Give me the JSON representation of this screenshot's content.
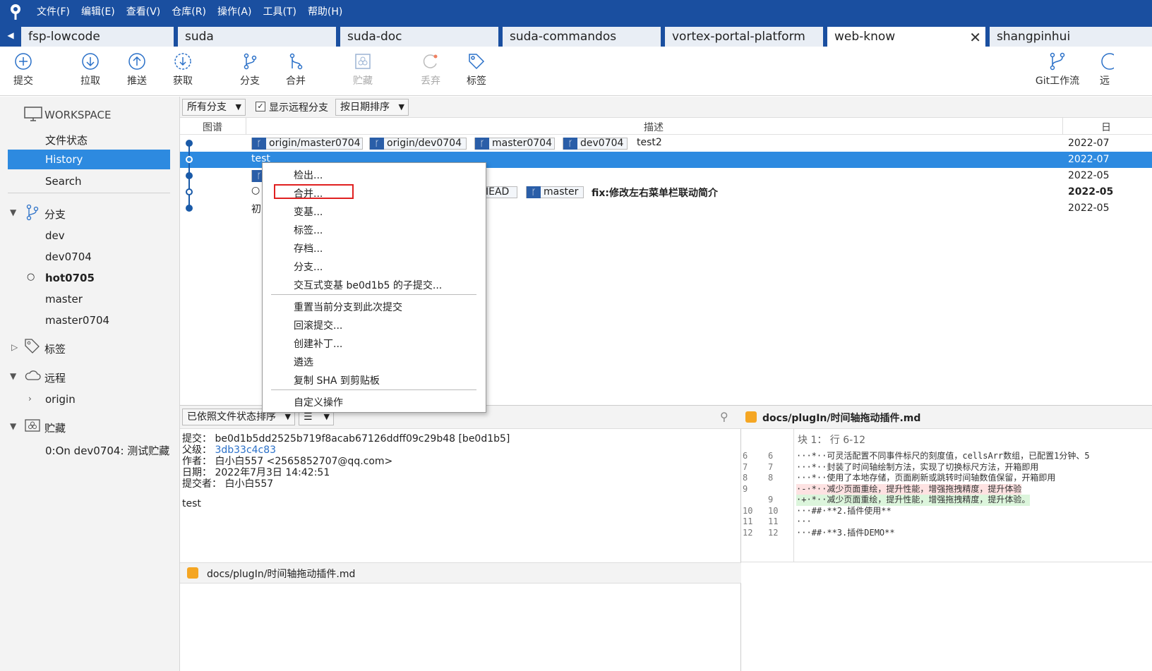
{
  "menu": [
    "文件(F)",
    "编辑(E)",
    "查看(V)",
    "仓库(R)",
    "操作(A)",
    "工具(T)",
    "帮助(H)"
  ],
  "tabs": [
    "fsp-lowcode",
    "suda",
    "suda-doc",
    "suda-commandos",
    "vortex-portal-platform",
    "web-know",
    "shangpinhui"
  ],
  "active_tab": "web-know",
  "toolbar": {
    "commit": "提交",
    "pull": "拉取",
    "push": "推送",
    "fetch": "获取",
    "branch": "分支",
    "merge": "合并",
    "stash": "贮藏",
    "discard": "丢弃",
    "tag": "标签",
    "gitflow": "Git工作流",
    "remote": "远"
  },
  "sidebar": {
    "workspace": "WORKSPACE",
    "file_status": "文件状态",
    "history": "History",
    "search": "Search",
    "branches": "分支",
    "branch_items": [
      "dev",
      "dev0704",
      "hot0705",
      "master",
      "master0704"
    ],
    "tags": "标签",
    "remotes": "远程",
    "remote_items": [
      "origin"
    ],
    "stashes": "贮藏",
    "stash_items": [
      "0:On dev0704: 测试贮藏"
    ]
  },
  "filter": {
    "branches": "所有分支",
    "show_remote": "显示远程分支",
    "sort": "按日期排序"
  },
  "columns": {
    "graph": "图谱",
    "desc": "描述",
    "date": "日"
  },
  "commits": [
    {
      "badges": [
        "origin/master0704",
        "origin/dev0704",
        "master0704",
        "dev0704"
      ],
      "msg": "test2",
      "date": "2022-07"
    },
    {
      "badges": [],
      "msg": "test",
      "date": "2022-07"
    },
    {
      "badges": [],
      "msg": "",
      "date": "2022-05"
    },
    {
      "badges": [
        "IEAD",
        "master"
      ],
      "msg": "fix:修改左右菜单栏联动简介",
      "date": "2022-05"
    },
    {
      "badges": [],
      "msg": "初",
      "date": "2022-05"
    }
  ],
  "context_menu": {
    "items": [
      "检出...",
      "合并...",
      "变基...",
      "标签...",
      "存档...",
      "分支...",
      "交互式变基 be0d1b5 的子提交...",
      "重置当前分支到此次提交",
      "回滚提交...",
      "创建补丁...",
      "遴选",
      "复制 SHA 到剪贴板",
      "自定义操作"
    ],
    "highlighted": "合并..."
  },
  "details": {
    "sort_label": "已依照文件状态排序",
    "commit_label": "提交：",
    "commit": "be0d1b5dd2525b719f8acab67126ddff09c29b48 [be0d1b5]",
    "parent_label": "父级：",
    "parent": "3db33c4c83",
    "author_label": "作者：",
    "author": "白小白557 <2565852707@qq.com>",
    "date_label": "日期：",
    "date": "2022年7月3日 14:42:51",
    "committer_label": "提交者：",
    "committer": "白小白557",
    "message": "test",
    "file": "docs/plugIn/时间轴拖动插件.md"
  },
  "diff": {
    "file": "docs/plugIn/时间轴拖动插件.md",
    "hunk": "块 1： 行 6-12",
    "lines": [
      {
        "o": "6",
        "n": "6",
        "t": "···*··可灵活配置不同事件标尺的刻度值，cellsArr数组，已配置1分钟、5",
        "k": "ctx"
      },
      {
        "o": "7",
        "n": "7",
        "t": "···*··封装了时间轴绘制方法，实现了切换标尺方法，开箱即用",
        "k": "ctx"
      },
      {
        "o": "8",
        "n": "8",
        "t": "···*··使用了本地存储，页面刷新或跳转时间轴数值保留，开箱即用",
        "k": "ctx"
      },
      {
        "o": "9",
        "n": "",
        "t": "·-·*··减少页面重绘，提升性能，增强拖拽精度，提升体验",
        "k": "del"
      },
      {
        "o": "",
        "n": "9",
        "t": "·+·*··减少页面重绘，提升性能，增强拖拽精度，提升体验。",
        "k": "add"
      },
      {
        "o": "10",
        "n": "10",
        "t": "···##·**2.插件使用**",
        "k": "ctx"
      },
      {
        "o": "11",
        "n": "11",
        "t": "···",
        "k": "ctx"
      },
      {
        "o": "12",
        "n": "12",
        "t": "···##·**3.插件DEMO**",
        "k": "ctx"
      }
    ]
  },
  "colors": {
    "accent": "#2d8ae0",
    "titlebar": "#1a4fa0",
    "highlight": "#e02020"
  }
}
